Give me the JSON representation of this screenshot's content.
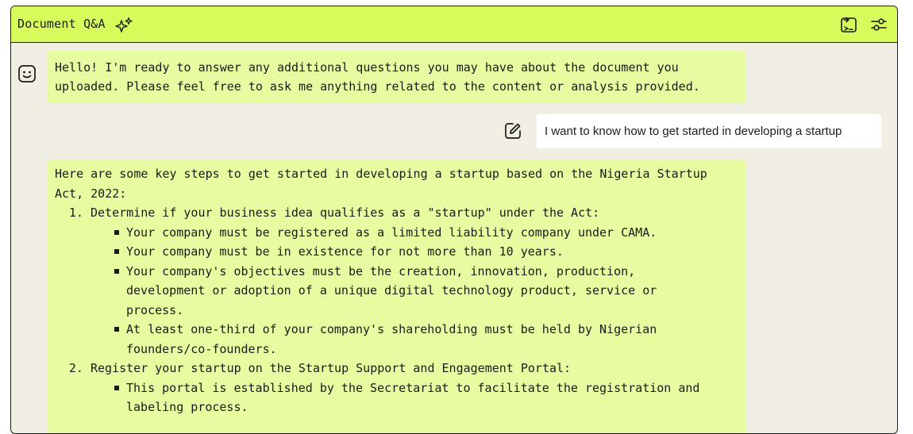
{
  "header": {
    "title": "Document Q&A",
    "sparkle_icon": "sparkles-icon",
    "export_icon": "export-chat-icon",
    "settings_icon": "settings-sliders-icon"
  },
  "colors": {
    "header_bg": "#d7fb5a",
    "bot_bubble_bg": "#e7fca0",
    "panel_bg": "#f1eee4",
    "user_bubble_bg": "#ffffff"
  },
  "messages": {
    "greeting": {
      "lines": [
        "Hello! I'm ready to answer any additional questions you may have about the document you",
        "uploaded. Please feel free to ask me anything related to the content or analysis provided."
      ]
    },
    "user": {
      "text": "I want to know how to get started in developing a startup"
    },
    "answer": {
      "intro": [
        "Here are some key steps to get started in developing a startup based on the Nigeria Startup",
        "Act, 2022:"
      ],
      "steps": [
        {
          "title": "Determine if your business idea qualifies as a \"startup\" under the Act:",
          "bullets": [
            [
              "Your company must be registered as a limited liability company under CAMA."
            ],
            [
              "Your company must be in existence for not more than 10 years."
            ],
            [
              "Your company's objectives must be the creation, innovation, production,",
              "development or adoption of a unique digital technology product, service or",
              "process."
            ],
            [
              "At least one-third of your company's shareholding must be held by Nigerian",
              "founders/co-founders."
            ]
          ]
        },
        {
          "title": "Register your startup on the Startup Support and Engagement Portal:",
          "bullets": [
            [
              "This portal is established by the Secretariat to facilitate the registration and",
              "labeling process."
            ]
          ]
        }
      ]
    }
  }
}
